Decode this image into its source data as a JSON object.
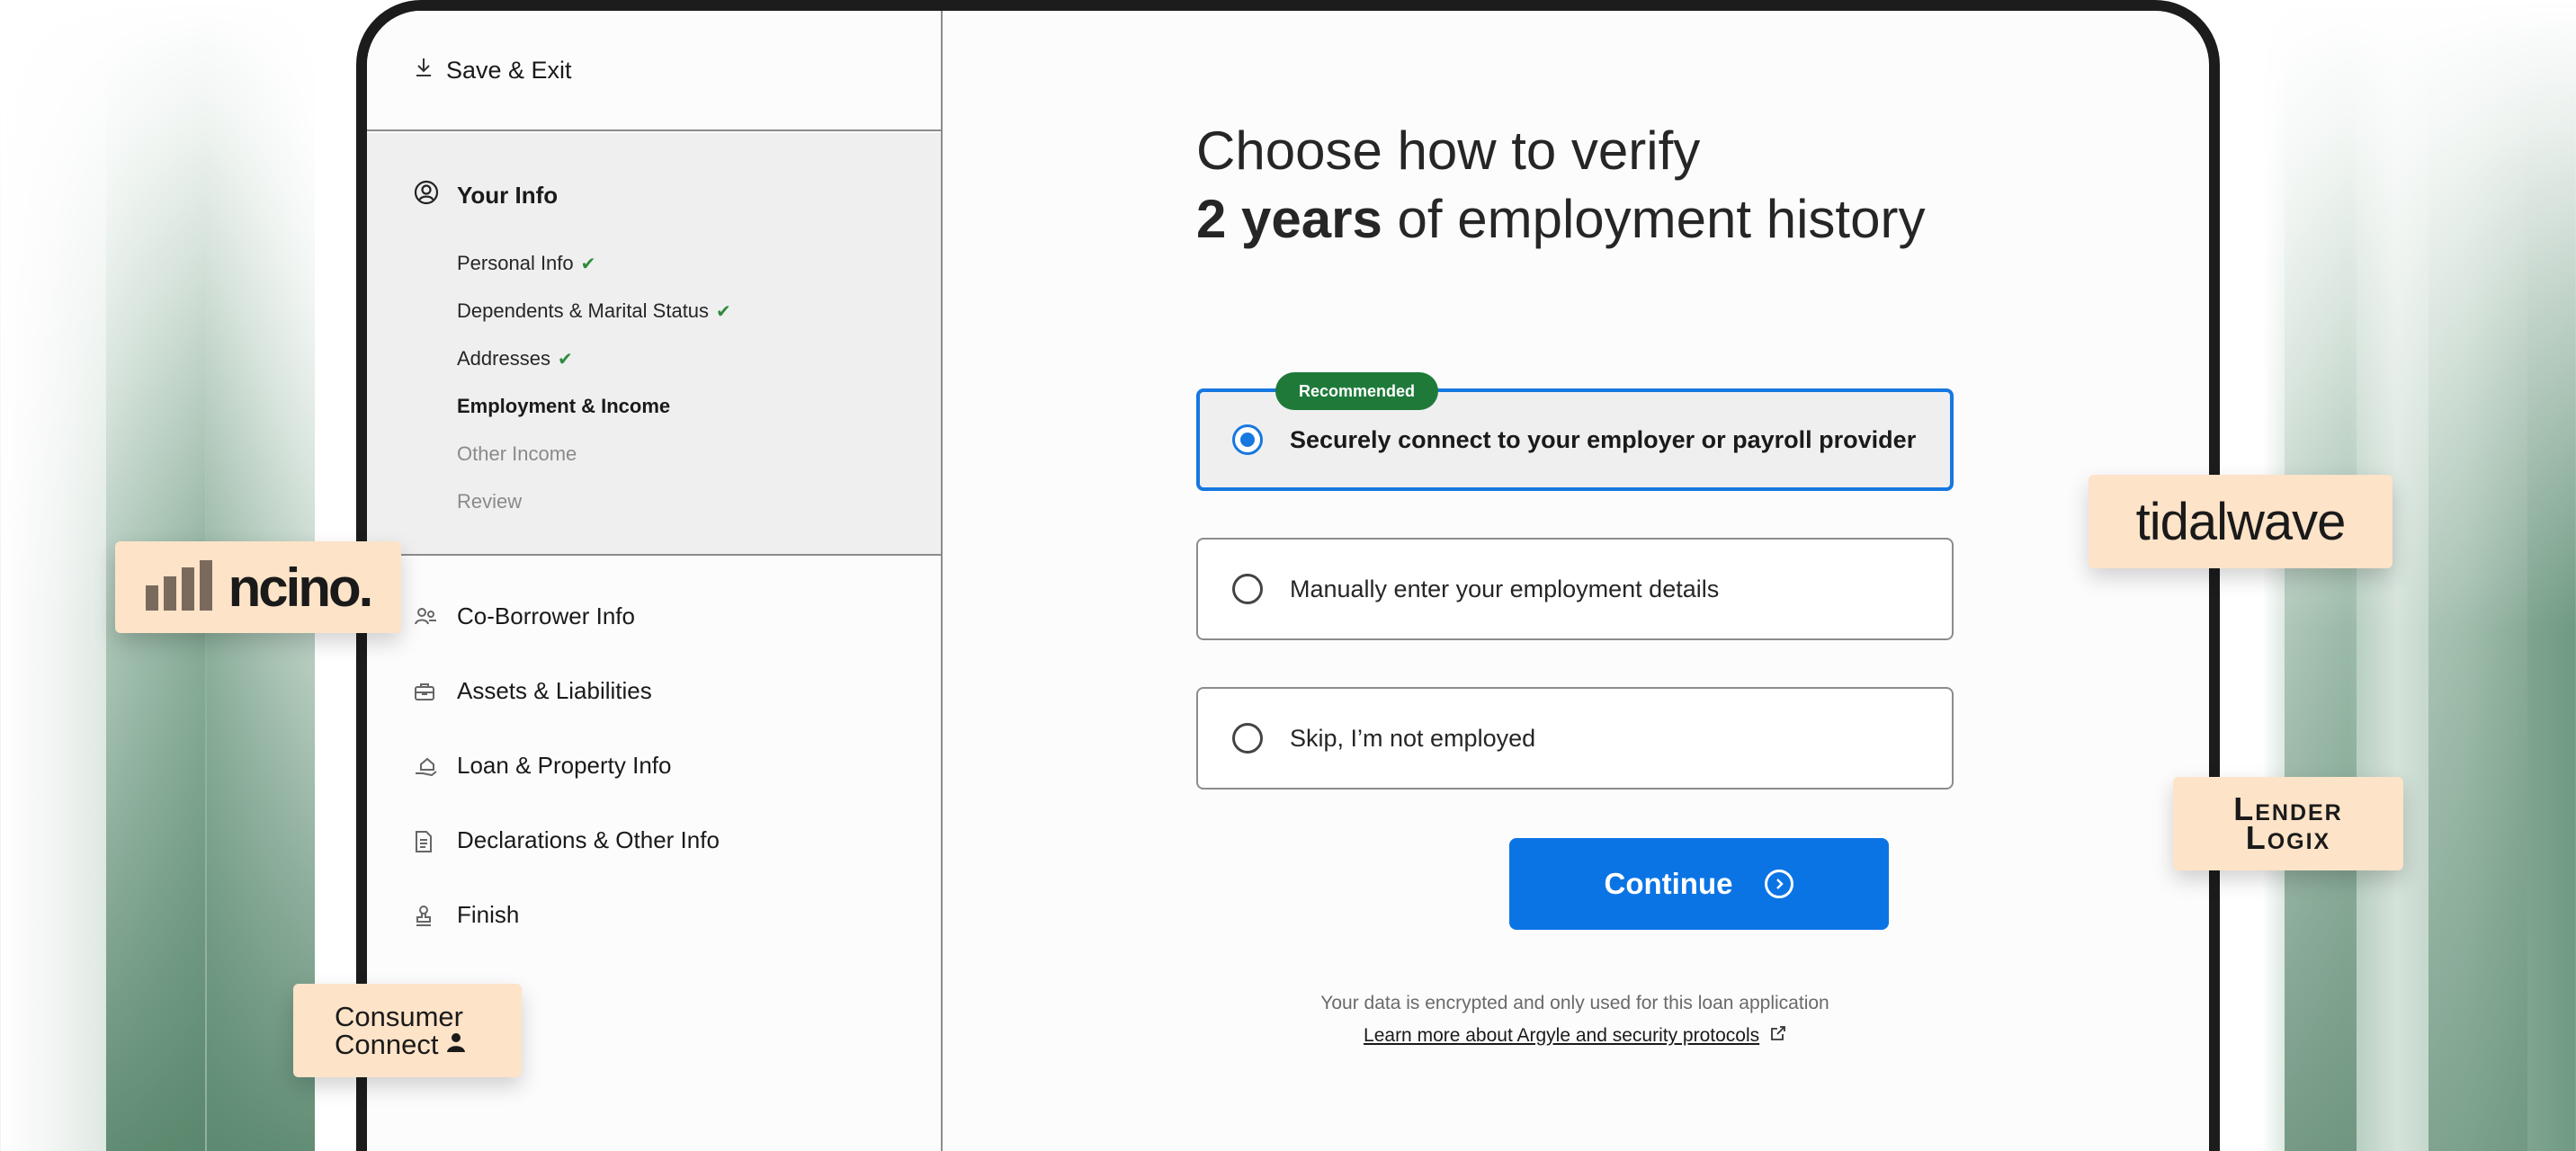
{
  "sidebar": {
    "save_exit": "Save & Exit",
    "section": {
      "title": "Your Info",
      "items": [
        {
          "label": "Personal Info",
          "state": "complete"
        },
        {
          "label": "Dependents & Marital Status",
          "state": "complete"
        },
        {
          "label": "Addresses",
          "state": "complete"
        },
        {
          "label": "Employment & Income",
          "state": "current"
        },
        {
          "label": "Other Income",
          "state": "upcoming"
        },
        {
          "label": "Review",
          "state": "upcoming"
        }
      ]
    },
    "nav": [
      {
        "label": "Co-Borrower Info",
        "icon": "co-borrower-icon"
      },
      {
        "label": "Assets & Liabilities",
        "icon": "briefcase-icon"
      },
      {
        "label": "Loan & Property Info",
        "icon": "house-hand-icon"
      },
      {
        "label": "Declarations & Other Info",
        "icon": "document-icon"
      },
      {
        "label": "Finish",
        "icon": "stamp-icon"
      }
    ]
  },
  "main": {
    "headline_line1": "Choose how to verify",
    "headline_bold": "2 years",
    "headline_rest": " of employment history",
    "badge": "Recommended",
    "options": [
      {
        "label": "Securely connect to your employer or payroll provider",
        "selected": true
      },
      {
        "label": "Manually enter your employment details",
        "selected": false
      },
      {
        "label": "Skip, I’m not employed",
        "selected": false
      }
    ],
    "continue_label": "Continue",
    "footnote": "Your data is encrypted and only used for this loan application",
    "learn_more": "Learn more about Argyle and security protocols"
  },
  "logos": {
    "ncino": "ncino.",
    "tidalwave": "tidalwave",
    "lender_line1": "Lender",
    "lender_line2": "Logix",
    "consumer_line1": "Consumer",
    "consumer_line2": "Connect"
  },
  "colors": {
    "accent": "#0b74e5",
    "badge": "#1f7a3a",
    "check": "#2e8b3d",
    "logo_card": "#fde3c8"
  }
}
